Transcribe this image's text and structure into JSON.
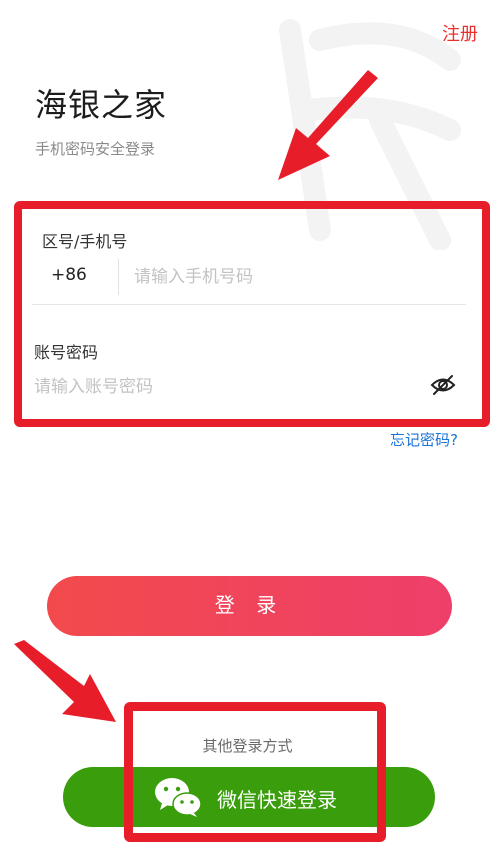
{
  "header": {
    "register_label": "注册"
  },
  "brand": {
    "title": "海银之家",
    "subtitle": "手机密码安全登录"
  },
  "form": {
    "phone_label": "区号/手机号",
    "country_code": "+86",
    "phone_placeholder": "请输入手机号码",
    "password_label": "账号密码",
    "password_placeholder": "请输入账号密码",
    "forgot_label": "忘记密码?"
  },
  "actions": {
    "login_label": "登 录"
  },
  "other": {
    "label": "其他登录方式",
    "wechat_label": "微信快速登录"
  },
  "colors": {
    "accent": "#e8312f",
    "link": "#1a73d9",
    "wechat": "#3a9d0c",
    "annotation": "#e81d2a"
  },
  "icons": [
    "eye-slash-icon",
    "wechat-icon",
    "annotation-arrow"
  ]
}
